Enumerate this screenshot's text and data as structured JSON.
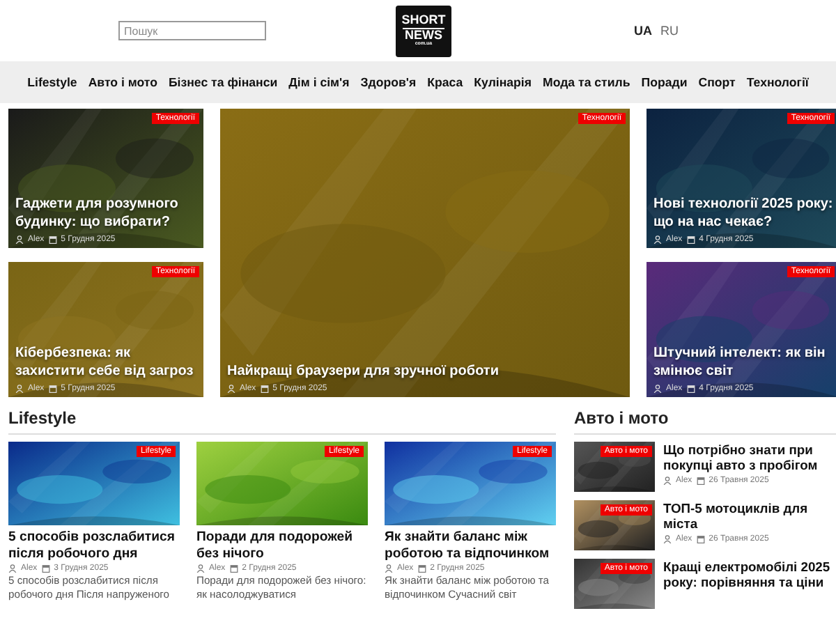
{
  "header": {
    "search": {
      "placeholder": "Пошук"
    },
    "logo": {
      "line_1": "SHORT",
      "line_2": "NEWS",
      "line_3": "com.ua"
    },
    "languages": [
      {
        "label": "UA",
        "selected": true
      },
      {
        "label": "RU",
        "selected": false
      }
    ]
  },
  "nav": {
    "items": [
      "Lifestyle",
      "Авто і мото",
      "Бізнес та фінанси",
      "Дім і сім'я",
      "Здоров'я",
      "Краса",
      "Кулінарія",
      "Мода та стиль",
      "Поради",
      "Спорт",
      "Технології"
    ]
  },
  "hero": {
    "left": [
      {
        "category": "Технології",
        "title": "Гаджети для розумного будинку: що вибрати?",
        "author": "Alex",
        "date": "5 Грудня 2025"
      },
      {
        "category": "Технології",
        "title": "Кібербезпека: як захистити себе від загроз",
        "author": "Alex",
        "date": "5 Грудня 2025"
      }
    ],
    "main": {
      "category": "Технології",
      "title": "Найкращі браузери для зручної роботи",
      "author": "Alex",
      "date": "5 Грудня 2025"
    },
    "right": [
      {
        "category": "Технології",
        "title": "Нові технології 2025 року: що на нас чекає?",
        "author": "Alex",
        "date": "4 Грудня 2025"
      },
      {
        "category": "Технології",
        "title": "Штучний інтелект: як він змінює світ",
        "author": "Alex",
        "date": "4 Грудня 2025"
      }
    ]
  },
  "lifestyle": {
    "title": "Lifestyle",
    "posts": [
      {
        "category": "Lifestyle",
        "title": "5 способів розслабитися після робочого дня",
        "author": "Alex",
        "date": "3 Грудня 2025",
        "excerpt": "5 способів розслабитися після робочого дня Після напруженого"
      },
      {
        "category": "Lifestyle",
        "title": "Поради для подорожей без нічого",
        "author": "Alex",
        "date": "2 Грудня 2025",
        "excerpt": "Поради для подорожей без нічого: як насолоджуватися"
      },
      {
        "category": "Lifestyle",
        "title": "Як знайти баланс між роботою та відпочинком",
        "author": "Alex",
        "date": "2 Грудня 2025",
        "excerpt": "Як знайти баланс між роботою та відпочинком Сучасний світ"
      }
    ]
  },
  "auto": {
    "title": "Авто і мото",
    "posts": [
      {
        "category": "Авто і мото",
        "title": "Що потрібно знати при покупці авто з пробігом",
        "author": "Alex",
        "date": "26 Травня 2025"
      },
      {
        "category": "Авто і мото",
        "title": "ТОП-5 мотоциклів для міста",
        "author": "Alex",
        "date": "26 Травня 2025"
      },
      {
        "category": "Авто і мото",
        "title": "Кращі електромобілі 2025 року: порівняння та ціни"
      }
    ]
  }
}
